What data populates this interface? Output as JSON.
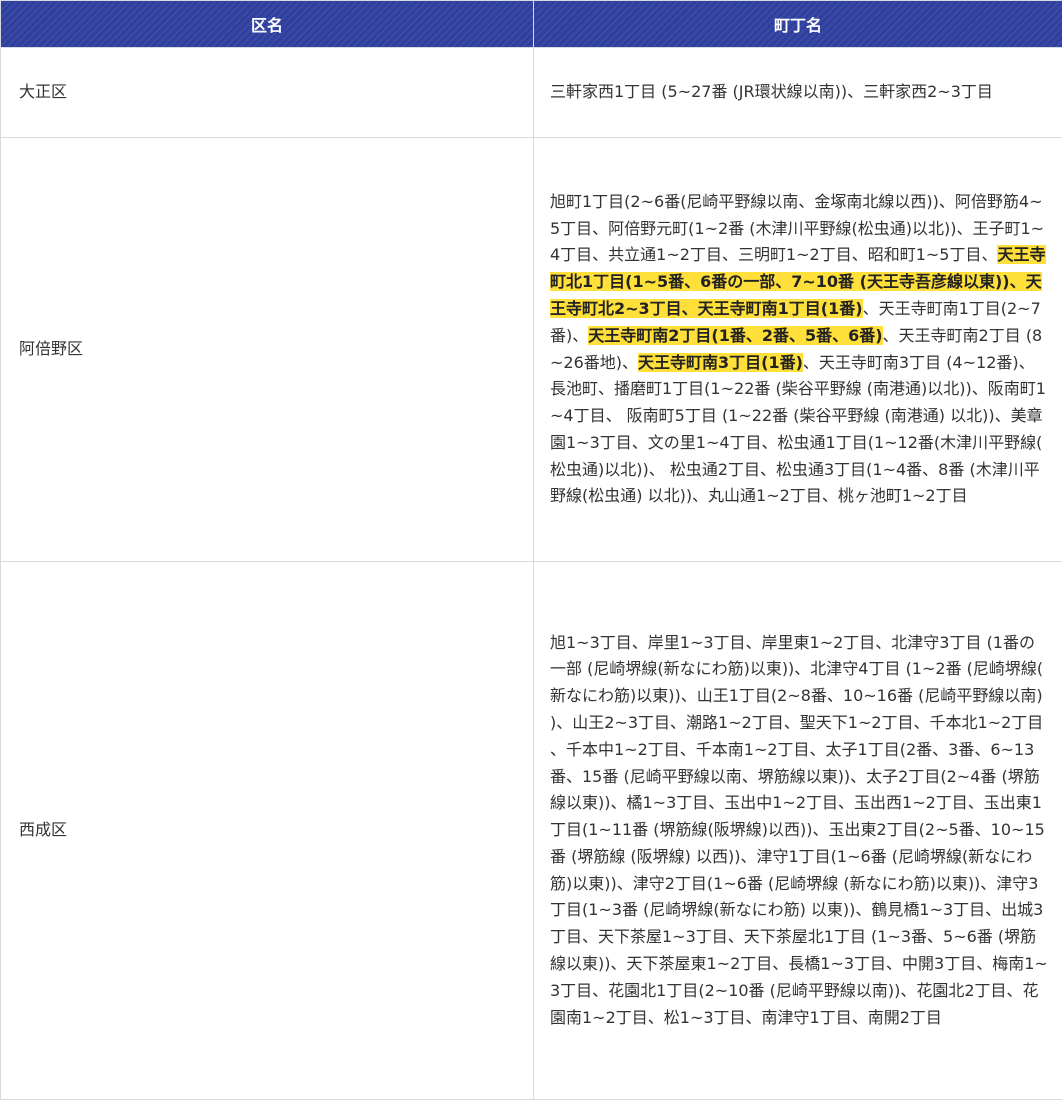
{
  "table": {
    "headers": [
      "区名",
      "町丁名"
    ],
    "highlight_color": "#ffe03a",
    "header_color": "#2f3f9e",
    "rows": [
      {
        "ward": "大正区",
        "segments": [
          {
            "text": "三軒家西1丁目 (5~27番 (JR環状線以南))、三軒家西2~3丁目",
            "hl": false
          }
        ]
      },
      {
        "ward": "阿倍野区",
        "segments": [
          {
            "text": "旭町1丁目(2~6番(尼崎平野線以南、金塚南北線以西))、阿倍野筋4~5丁目、阿倍野元町(1~2番 (木津川平野線(松虫通)以北))、王子町1~4丁目、共立通1~2丁目、三明町1~2丁目、昭和町1~5丁目、",
            "hl": false
          },
          {
            "text": "天王寺町北1丁目(1~5番、6番の一部、7~10番 (天王寺吾彦線以東))、天王寺町北2~3丁目、天王寺町南1丁目(1番)",
            "hl": true
          },
          {
            "text": "、天王寺町南1丁目(2~7番)、",
            "hl": false
          },
          {
            "text": "天王寺町南2丁目(1番、2番、5番、6番)",
            "hl": true
          },
          {
            "text": "、天王寺町南2丁目 (8~26番地)、",
            "hl": false
          },
          {
            "text": "天王寺町南3丁目(1番)",
            "hl": true
          },
          {
            "text": "、天王寺町南3丁目 (4~12番)、長池町、播磨町1丁目(1~22番 (柴谷平野線 (南港通)以北))、阪南町1~4丁目、 阪南町5丁目 (1~22番 (柴谷平野線 (南港通) 以北))、美章園1~3丁目、文の里1~4丁目、松虫通1丁目(1~12番(木津川平野線(松虫通)以北))、 松虫通2丁目、松虫通3丁目(1~4番、8番 (木津川平野線(松虫通) 以北))、丸山通1~2丁目、桃ヶ池町1~2丁目",
            "hl": false
          }
        ]
      },
      {
        "ward": "西成区",
        "segments": [
          {
            "text": "旭1~3丁目、岸里1~3丁目、岸里東1~2丁目、北津守3丁目 (1番の一部 (尼崎堺線(新なにわ筋)以東))、北津守4丁目 (1~2番 (尼崎堺線(新なにわ筋)以東))、山王1丁目(2~8番、10~16番 (尼崎平野線以南))、山王2~3丁目、潮路1~2丁目、聖天下1~2丁目、千本北1~2丁目、千本中1~2丁目、千本南1~2丁目、太子1丁目(2番、3番、6~13番、15番 (尼崎平野線以南、堺筋線以東))、太子2丁目(2~4番 (堺筋線以東))、橘1~3丁目、玉出中1~2丁目、玉出西1~2丁目、玉出東1丁目(1~11番 (堺筋線(阪堺線)以西))、玉出東2丁目(2~5番、10~15番 (堺筋線 (阪堺線) 以西))、津守1丁目(1~6番 (尼崎堺線(新なにわ筋)以東))、津守2丁目(1~6番 (尼崎堺線 (新なにわ筋)以東))、津守3丁目(1~3番 (尼崎堺線(新なにわ筋) 以東))、鶴見橋1~3丁目、出城3丁目、天下茶屋1~3丁目、天下茶屋北1丁目 (1~3番、5~6番 (堺筋線以東))、天下茶屋東1~2丁目、長橋1~3丁目、中開3丁目、梅南1~3丁目、花園北1丁目(2~10番 (尼崎平野線以南))、花園北2丁目、花園南1~2丁目、松1~3丁目、南津守1丁目、南開2丁目",
            "hl": false
          }
        ]
      }
    ]
  }
}
